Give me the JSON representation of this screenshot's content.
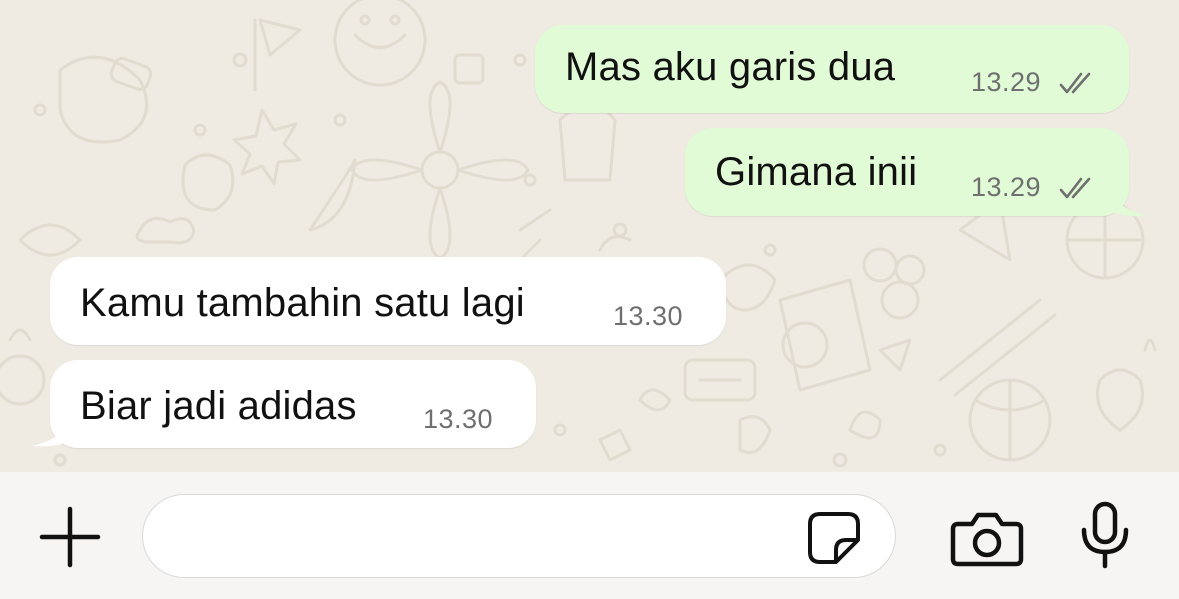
{
  "messages": [
    {
      "direction": "out",
      "text": "Mas aku garis dua",
      "time": "13.29",
      "status": "read"
    },
    {
      "direction": "out",
      "text": "Gimana inii",
      "time": "13.29",
      "status": "read"
    },
    {
      "direction": "in",
      "text": "Kamu tambahin satu lagi",
      "time": "13.30"
    },
    {
      "direction": "in",
      "text": "Biar jadi adidas",
      "time": "13.30"
    }
  ],
  "composer": {
    "placeholder": "",
    "icons": [
      "plus-icon",
      "sticker-icon",
      "camera-icon",
      "microphone-icon"
    ]
  },
  "colors": {
    "outgoing_bubble": "#e1fbd6",
    "incoming_bubble": "#ffffff",
    "chat_background": "#efeae2",
    "read_ticks": "#6f6f6f"
  }
}
